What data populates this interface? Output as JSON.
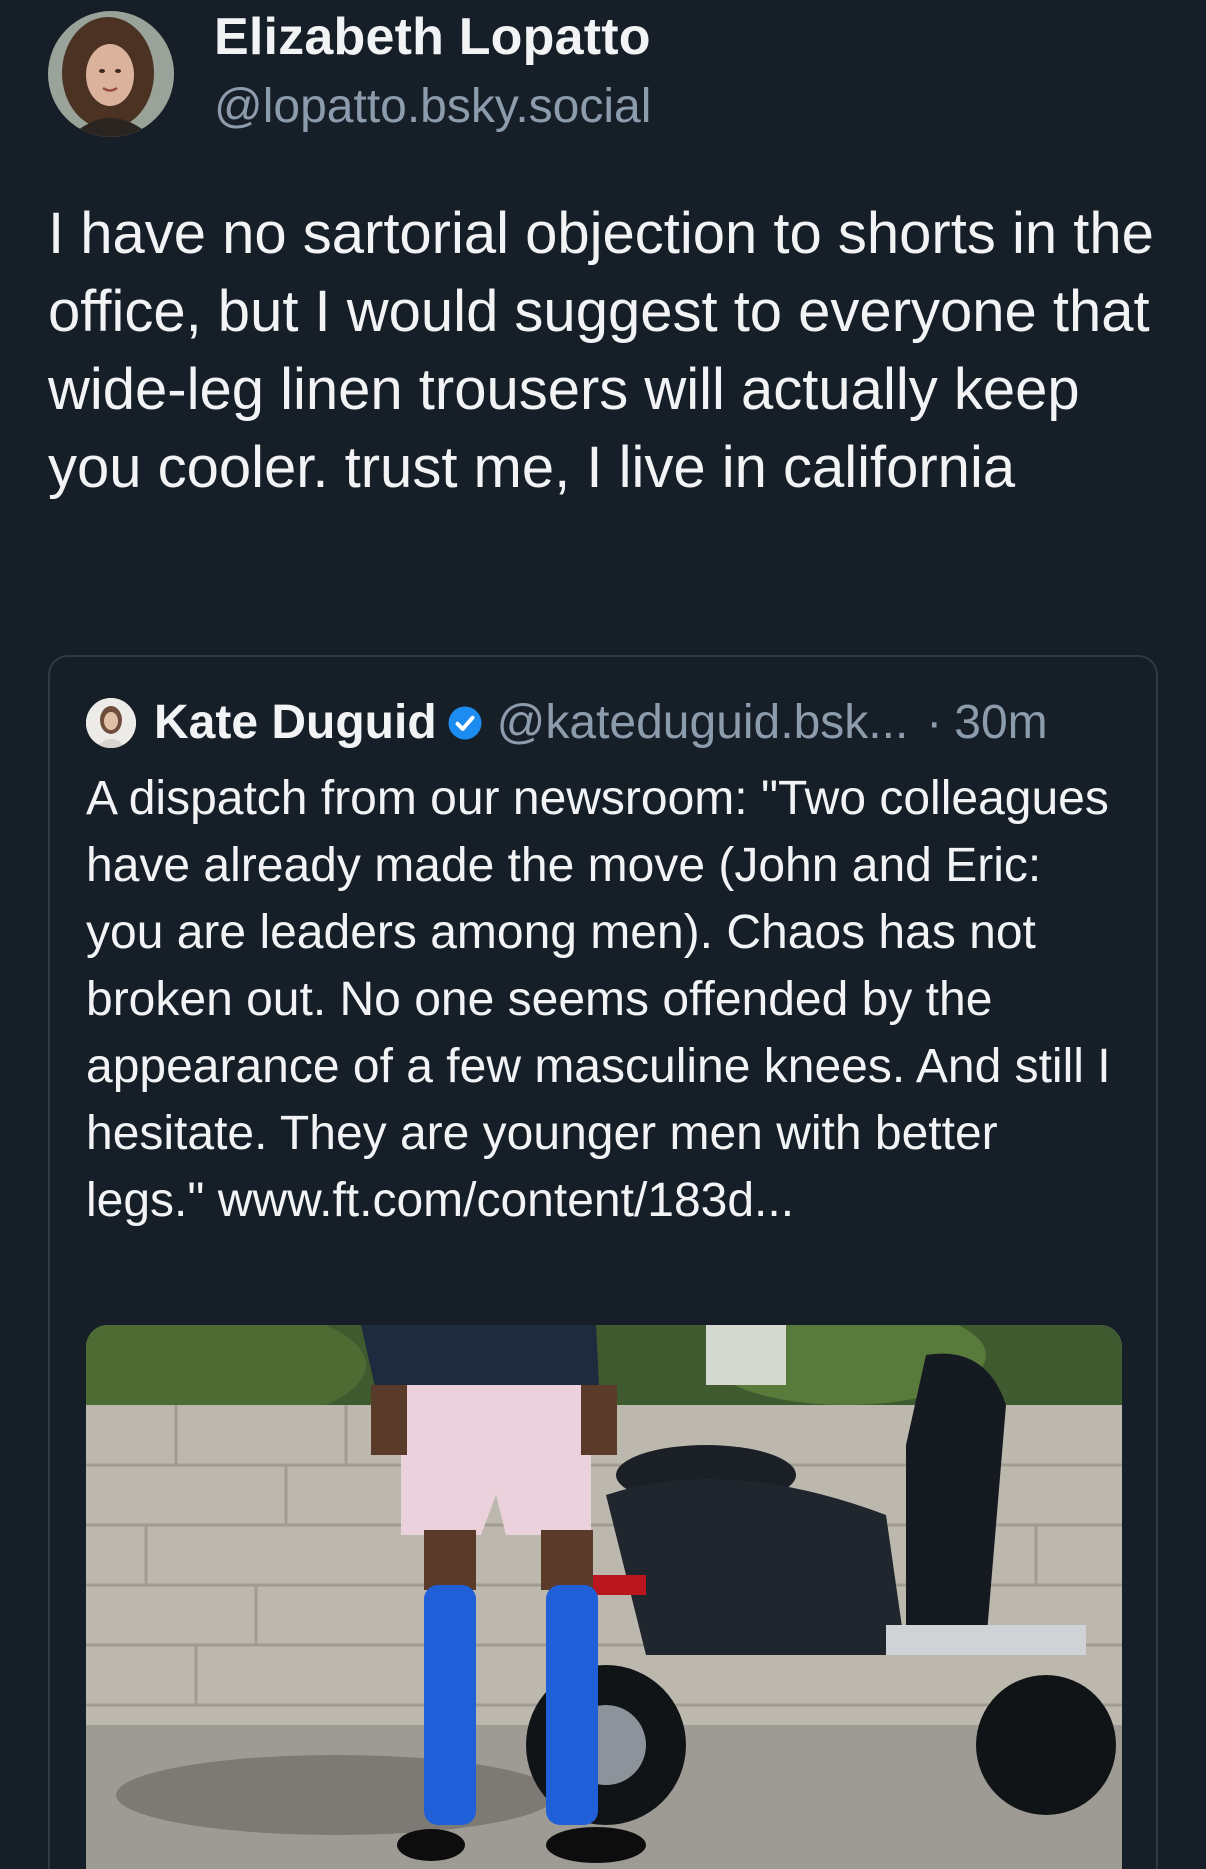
{
  "post": {
    "author": {
      "display_name": "Elizabeth Lopatto",
      "handle": "@lopatto.bsky.social",
      "avatar": "author-avatar"
    },
    "text": "I have no sartorial objection to shorts in the office, but I would suggest to everyone that wide-leg linen trousers will actually keep you cooler. trust me, I live in california",
    "quoted_post": {
      "author": {
        "display_name": "Kate Duguid",
        "handle": "@kateduguid.bsk...",
        "verified_icon": "verified-check-icon",
        "avatar": "quoted-author-avatar"
      },
      "separator": "·",
      "time": "30m",
      "text": "A dispatch from our newsroom: \"Two colleagues have already made the move (John and Eric: you are leaders among men). Chaos has not broken out. No one seems offended by the appearance of a few masculine knees. And still I hesitate. They are younger men with better legs.\"",
      "link": "www.ft.com/content/183d...",
      "image": "man-in-pink-shorts-blue-socks-beside-scooter-photo"
    }
  },
  "colors": {
    "background": "#161e27",
    "text": "#f1f3f5",
    "secondary_text": "#8c9cad",
    "border": "#2e3a47",
    "verified": "#1d8cf0"
  }
}
